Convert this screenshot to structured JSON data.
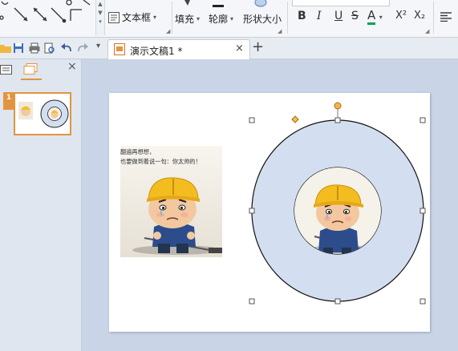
{
  "ribbon": {
    "textbox_label": "文本框",
    "fill_label": "填充",
    "outline_label": "轮廓",
    "shape_effect_label": "形状大小",
    "bold": "B",
    "italic": "I",
    "underline": "U",
    "strike": "S",
    "font_color": "A",
    "superscript": "X²",
    "subscript": "X₂"
  },
  "tabbar": {
    "doc_title": "演示文稿1 *",
    "close_glyph": "×",
    "new_tab_glyph": "+"
  },
  "panel": {
    "close_glyph": "×",
    "slide_number": "1"
  },
  "slide": {
    "caption": "翻遍再想想，\n也要做到着说一句：你太帅的！"
  },
  "colors": {
    "accent": "#e3943f",
    "ring_fill": "#d3def0",
    "canvas_bg": "#c9d5e6"
  }
}
